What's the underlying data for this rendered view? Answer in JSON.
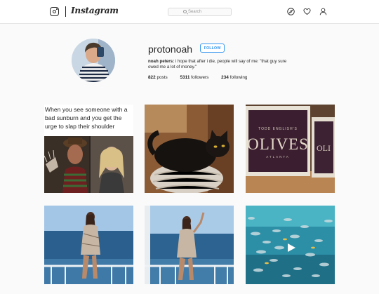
{
  "header": {
    "wordmark": "Instagram",
    "search_placeholder": "Search",
    "icons": [
      "instagram-logo-icon",
      "compass-icon",
      "heart-icon",
      "person-icon"
    ]
  },
  "profile": {
    "username": "protonoah",
    "follow_label": "FOLLOW",
    "full_name": "noah peters:",
    "bio": " i hope that after i die, people will say of me: \"that guy sure owed me a lot of money.\"",
    "posts_count": "822",
    "posts_label": " posts",
    "followers_count": "5311",
    "followers_label": " followers",
    "following_count": "234",
    "following_label": " following"
  },
  "posts": [
    {
      "kind": "meme",
      "text": "When you see someone with a bad sunburn and you get the urge to slap their shoulder"
    },
    {
      "kind": "photo",
      "subject": "black cat"
    },
    {
      "kind": "photo",
      "subject": "olives restaurant sign",
      "sign_small": "TODD ENGLISH'S",
      "sign_big": "OLIVES",
      "sign_sub": "ATLANTA"
    },
    {
      "kind": "photo",
      "subject": "woman on balcony"
    },
    {
      "kind": "photo",
      "subject": "woman on balcony waving"
    },
    {
      "kind": "video",
      "subject": "fish in aquarium",
      "icon": "play-icon"
    }
  ]
}
